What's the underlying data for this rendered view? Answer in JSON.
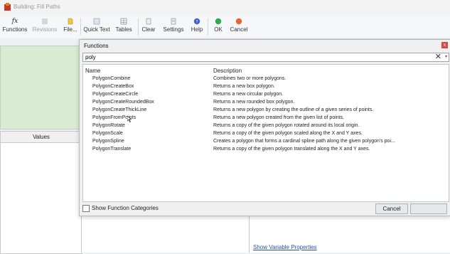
{
  "window": {
    "title": "Building: Fill Paths"
  },
  "toolbar": {
    "functions": "Functions",
    "revisions": "Revisions",
    "file": "File...",
    "quick_text": "Quick Text",
    "tables": "Tables",
    "clear": "Clear",
    "settings": "Settings",
    "help": "Help",
    "ok": "OK",
    "cancel": "Cancel"
  },
  "panels": {
    "values_header": "Values",
    "show_variable_properties": "Show Variable Properties"
  },
  "dialog": {
    "title": "Functions",
    "close_glyph": "x",
    "search_value": "poly",
    "clear_glyph": "✕",
    "dropdown_glyph": "▾",
    "columns": {
      "name": "Name",
      "description": "Description"
    },
    "rows": [
      {
        "name": "PolygonCombine",
        "description": "Combines two or more polygons."
      },
      {
        "name": "PolygonCreateBox",
        "description": "Returns a new box polygon."
      },
      {
        "name": "PolygonCreateCircle",
        "description": "Returns a new circular polygon."
      },
      {
        "name": "PolygonCreateRoundedBox",
        "description": "Returns a new rounded box polygon."
      },
      {
        "name": "PolygonCreateThickLine",
        "description": "Returns a new polygon by creating the outline of a given series of points."
      },
      {
        "name": "PolygonFromPoints",
        "description": "Returns a new polygon created from the given list of points."
      },
      {
        "name": "PolygonRotate",
        "description": "Returns a copy of the given polygon rotated around its local origin."
      },
      {
        "name": "PolygonScale",
        "description": "Returns a copy of the given polygon scaled along the X and Y axes."
      },
      {
        "name": "PolygonSpline",
        "description": "Creates a polygon that forms a cardinal spline path along the given polygon's poi..."
      },
      {
        "name": "PolygonTranslate",
        "description": "Returns a copy of the given polygon translated along the X and Y axes."
      }
    ],
    "show_categories_label": "Show Function Categories",
    "show_categories_checked": false,
    "cancel_label": "Cancel",
    "ok_label": ""
  },
  "colors": {
    "ok_icon": "#2fa84f",
    "cancel_icon": "#e8652b",
    "help_icon": "#3d5fcf",
    "close_button": "#e04343",
    "link": "#2a4fb5",
    "green_pane": "#d9ecd3"
  }
}
